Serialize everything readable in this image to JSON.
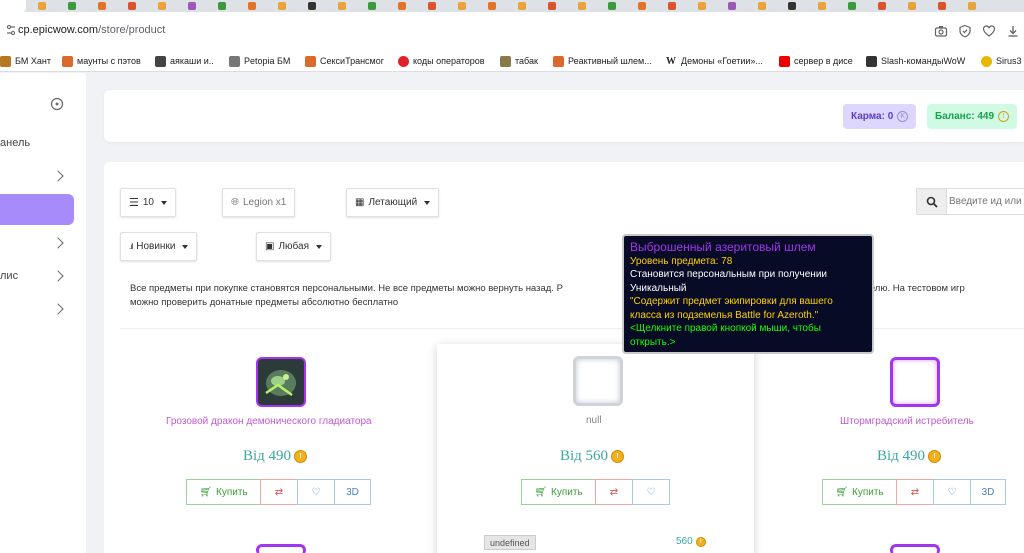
{
  "browser": {
    "url_host": "cp.epicwow.com",
    "url_path": "/store/product",
    "bookmarks": [
      {
        "label": "БМ Хант",
        "icon": "wow-icon",
        "color": "#b7791f"
      },
      {
        "label": "маунты с пэтов",
        "icon": "rocket-icon",
        "color": "#d96a2b"
      },
      {
        "label": "аякаши и..",
        "icon": "game-icon",
        "color": "#444"
      },
      {
        "label": "Petopia БМ",
        "icon": "paw-icon",
        "color": "#777"
      },
      {
        "label": "СексиТрансмог",
        "icon": "rocket-icon",
        "color": "#d96a2b"
      },
      {
        "label": "коды операторов",
        "icon": "opera-icon",
        "color": "#e0202a"
      },
      {
        "label": "табак",
        "icon": "game-icon",
        "color": "#8a7a4a"
      },
      {
        "label": "Реактивный шлем...",
        "icon": "rocket-icon",
        "color": "#d96a2b"
      },
      {
        "label": "Демоны «Гоетии»...",
        "icon": "wikipedia-icon",
        "color": "#000"
      },
      {
        "label": "сервер в дисе",
        "icon": "youtube-icon",
        "color": "#e00"
      },
      {
        "label": "Slash-командыWoW",
        "icon": "game-icon",
        "color": "#333"
      },
      {
        "label": "Sirus3",
        "icon": "sirus-icon",
        "color": "#e6b800"
      }
    ]
  },
  "sidebar": {
    "items": [
      {
        "label": "анель"
      },
      {
        "label": ""
      },
      {
        "label": ""
      },
      {
        "label": ""
      },
      {
        "label": "лис"
      },
      {
        "label": ""
      }
    ]
  },
  "topbar": {
    "karma_label": "Карма: 0",
    "karma_coin": "K",
    "balance_label": "Баланс: 449",
    "balance_coin": "!"
  },
  "filters": {
    "per_page": "10",
    "realm": "Legion x1",
    "category": "Летающий",
    "sort": "Новинки",
    "price": "Любая",
    "search_placeholder": "Введите ид или"
  },
  "notice": {
    "line1_left": "Все предметы при покупке становятся персональными. Не все предметы можно вернуть назад. Р",
    "line1_right": "покупателю. На тестовом игр",
    "line2": "можно проверить донатные предметы абсолютно бесплатно"
  },
  "products": [
    {
      "name": "Грозовой дракон демонического гладиатора",
      "price": "Від 490"
    },
    {
      "name": "null",
      "price": "Від 560"
    },
    {
      "name": "Штормградский истребитель",
      "price": "Від 490"
    }
  ],
  "buttons": {
    "buy": "Купить",
    "d3": "3D"
  },
  "hover_detail": {
    "badge": "undefined",
    "price": "560"
  },
  "tooltip": {
    "title": "Выброшенный азеритовый шлем",
    "item_level": "Уровень предмета: 78",
    "bind": "Становится персональным при получении",
    "unique": "Уникальный",
    "description": "\"Содержит предмет экипировки для вашего класса из подземелья Battle for Azeroth.\"",
    "hint": "<Щелкните правой кнопкой мыши, чтобы открыть.>"
  },
  "colors": {
    "accent_purple": "#a78bfa",
    "item_name": "#c05ad0",
    "price": "#3aa9a0",
    "epic": "#a335ee"
  }
}
